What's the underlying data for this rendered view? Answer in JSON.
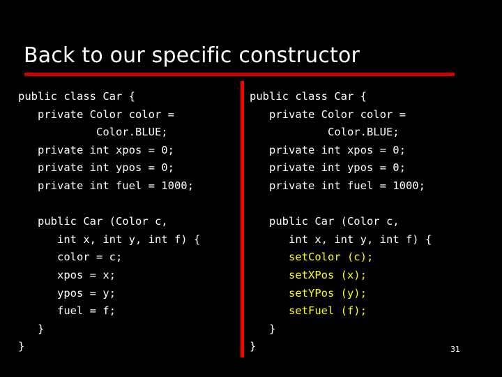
{
  "slide": {
    "title": "Back to our specific constructor",
    "page_number": "31",
    "accent_color": "#cc0000",
    "divider_color": "#ff0000",
    "highlight_color": "#ffff00",
    "text_color": "#ffffff",
    "background_color": "#000000"
  },
  "code_left": {
    "lines": [
      "public class Car {",
      "   private Color color =",
      "            Color.BLUE;",
      "   private int xpos = 0;",
      "   private int ypos = 0;",
      "   private int fuel = 1000;",
      "",
      "   public Car (Color c,",
      "      int x, int y, int f) {",
      "      color = c;",
      "      xpos = x;",
      "      ypos = y;",
      "      fuel = f;",
      "   }",
      "}"
    ]
  },
  "code_right": {
    "lines": [
      {
        "text": "public class Car {",
        "highlight": false
      },
      {
        "text": "   private Color color =",
        "highlight": false
      },
      {
        "text": "            Color.BLUE;",
        "highlight": false
      },
      {
        "text": "   private int xpos = 0;",
        "highlight": false
      },
      {
        "text": "   private int ypos = 0;",
        "highlight": false
      },
      {
        "text": "   private int fuel = 1000;",
        "highlight": false
      },
      {
        "text": "",
        "highlight": false
      },
      {
        "text": "   public Car (Color c,",
        "highlight": false
      },
      {
        "text": "      int x, int y, int f) {",
        "highlight": false
      },
      {
        "text": "      setColor (c);",
        "highlight": true
      },
      {
        "text": "      setXPos (x);",
        "highlight": true
      },
      {
        "text": "      setYPos (y);",
        "highlight": true
      },
      {
        "text": "      setFuel (f);",
        "highlight": true
      },
      {
        "text": "   }",
        "highlight": false
      },
      {
        "text": "}",
        "highlight": false
      }
    ]
  }
}
